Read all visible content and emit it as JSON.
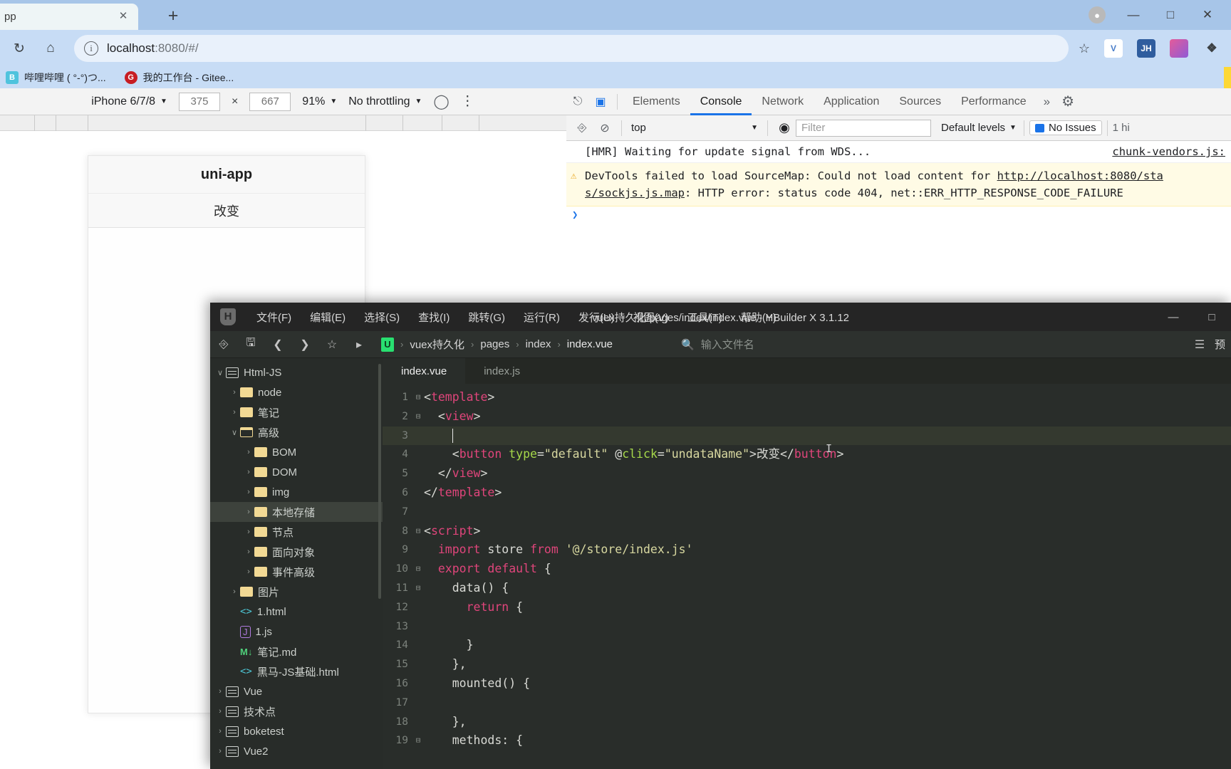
{
  "browser": {
    "tab_title": "pp",
    "close_icon": "close-icon",
    "new_tab_icon": "plus-icon",
    "reload_icon": "reload-icon",
    "home_icon": "home-icon",
    "url_info_icon": "info-icon",
    "url": "localhost:8080/#/",
    "url_host": "localhost",
    "url_path": ":8080/#/",
    "star_icon": "star-icon",
    "extensions": [
      {
        "name": "extension-v",
        "label": "V",
        "color": "#f0f0f0",
        "text_color": "#4a7ec9"
      },
      {
        "name": "extension-jh",
        "label": "JH",
        "color": "#2f5d9e",
        "text_color": "#ffffff"
      },
      {
        "name": "extension-colorful",
        "label": "",
        "color": "#d94f7a",
        "text_color": "#ffffff"
      },
      {
        "name": "extension-puzzle",
        "label": "❖",
        "color": "transparent",
        "text_color": "#3c4043"
      }
    ],
    "window_buttons": [
      "—",
      "□",
      "✕"
    ],
    "bookmarks": [
      {
        "label": "哔哩哔哩 ( °-°)つ...",
        "icon_label": "B",
        "icon_color": "#4fc3dd"
      },
      {
        "label": "我的工作台 - Gitee...",
        "icon_label": "G",
        "icon_color": "#c71d23"
      }
    ]
  },
  "devtools": {
    "device_toolbar": {
      "device": "iPhone 6/7/8",
      "width": "375",
      "height": "667",
      "separator": "×",
      "zoom": "91%",
      "throttling": "No throttling",
      "rotate_icon": "rotate-icon",
      "more_icon": "kebab-menu-icon"
    },
    "panel_tabs": [
      {
        "label": "Elements",
        "selected": false
      },
      {
        "label": "Console",
        "selected": true
      },
      {
        "label": "Network",
        "selected": false
      },
      {
        "label": "Application",
        "selected": false
      },
      {
        "label": "Sources",
        "selected": false
      },
      {
        "label": "Performance",
        "selected": false
      }
    ],
    "more_tabs": "»",
    "settings_icon": "gear-icon",
    "inspect_icon": "inspect-element-icon",
    "device_toggle_icon": "device-toolbar-icon",
    "console_toolbar": {
      "sidebar_icon": "console-sidebar-icon",
      "clear_icon": "clear-console-icon",
      "context": "top",
      "eye_icon": "live-expression-icon",
      "filter_placeholder": "Filter",
      "levels": "Default levels",
      "issues": "No Issues",
      "hidden": "1 hi"
    },
    "messages": [
      {
        "type": "log",
        "text": "[HMR] Waiting for update signal from WDS...",
        "source": "chunk-vendors.js:"
      },
      {
        "type": "warning",
        "text_part1": "DevTools failed to load SourceMap: Could not load content for ",
        "link1": "http://localhost:8080/sta",
        "link2": "s/sockjs.js.map",
        "text_part2": ": HTTP error: status code 404, net::ERR_HTTP_RESPONSE_CODE_FAILURE"
      }
    ]
  },
  "preview": {
    "app_title": "uni-app",
    "button_label": "改变"
  },
  "hbuilder": {
    "window_title": "vuex持久化/pages/index/index.vue - HBuilder X 3.1.12",
    "logo": "H",
    "menus": [
      "文件(F)",
      "编辑(E)",
      "选择(S)",
      "查找(I)",
      "跳转(G)",
      "运行(R)",
      "发行(U)",
      "视图(V)",
      "工具(T)",
      "帮助(Y)"
    ],
    "window_buttons": [
      "—",
      "□"
    ],
    "toolbar_icons": [
      "toggle-sidebar-icon",
      "save-icon",
      "back-icon",
      "forward-icon",
      "favorite-icon",
      "run-icon"
    ],
    "breadcrumb": {
      "project_icon": "uniapp-project-icon",
      "items": [
        "vuex持久化",
        "pages",
        "index",
        "index.vue"
      ],
      "separator": "›"
    },
    "file_search_placeholder": "输入文件名",
    "file_search_icon": "file-search-icon",
    "filter_icon": "filter-icon",
    "preview_label": "预",
    "tree": [
      {
        "label": "Html-JS",
        "depth": 0,
        "twisty": "∨",
        "icon": "project",
        "selected": false
      },
      {
        "label": "node",
        "depth": 1,
        "twisty": "›",
        "icon": "folder-closed",
        "selected": false
      },
      {
        "label": "笔记",
        "depth": 1,
        "twisty": "›",
        "icon": "folder-closed",
        "selected": false
      },
      {
        "label": "高级",
        "depth": 1,
        "twisty": "∨",
        "icon": "folder-open",
        "selected": false
      },
      {
        "label": "BOM",
        "depth": 2,
        "twisty": "›",
        "icon": "folder-closed",
        "selected": false
      },
      {
        "label": "DOM",
        "depth": 2,
        "twisty": "›",
        "icon": "folder-closed",
        "selected": false
      },
      {
        "label": "img",
        "depth": 2,
        "twisty": "›",
        "icon": "folder-closed",
        "selected": false
      },
      {
        "label": "本地存储",
        "depth": 2,
        "twisty": "›",
        "icon": "folder-closed",
        "selected": true
      },
      {
        "label": "节点",
        "depth": 2,
        "twisty": "›",
        "icon": "folder-closed",
        "selected": false
      },
      {
        "label": "面向对象",
        "depth": 2,
        "twisty": "›",
        "icon": "folder-closed",
        "selected": false
      },
      {
        "label": "事件高级",
        "depth": 2,
        "twisty": "›",
        "icon": "folder-closed",
        "selected": false
      },
      {
        "label": "图片",
        "depth": 1,
        "twisty": "›",
        "icon": "folder-closed",
        "selected": false
      },
      {
        "label": "1.html",
        "depth": 1,
        "twisty": "",
        "icon": "html",
        "selected": false
      },
      {
        "label": "1.js",
        "depth": 1,
        "twisty": "",
        "icon": "js",
        "selected": false
      },
      {
        "label": "笔记.md",
        "depth": 1,
        "twisty": "",
        "icon": "md",
        "selected": false
      },
      {
        "label": "黑马-JS基础.html",
        "depth": 1,
        "twisty": "",
        "icon": "html",
        "selected": false
      },
      {
        "label": "Vue",
        "depth": 0,
        "twisty": "›",
        "icon": "project",
        "selected": false
      },
      {
        "label": "技术点",
        "depth": 0,
        "twisty": "›",
        "icon": "project",
        "selected": false
      },
      {
        "label": "boketest",
        "depth": 0,
        "twisty": "›",
        "icon": "project",
        "selected": false
      },
      {
        "label": "Vue2",
        "depth": 0,
        "twisty": "›",
        "icon": "project",
        "selected": false
      }
    ],
    "editor_tabs": [
      {
        "label": "index.vue",
        "selected": true
      },
      {
        "label": "index.js",
        "selected": false
      }
    ],
    "code_lines": [
      {
        "n": "1",
        "fold": "⊟",
        "cur": false,
        "text": "<template>"
      },
      {
        "n": "2",
        "fold": "⊟",
        "cur": false,
        "text": "  <view>"
      },
      {
        "n": "3",
        "fold": "",
        "cur": true,
        "text": "    "
      },
      {
        "n": "4",
        "fold": "",
        "cur": false,
        "text": "    <button type=\"default\" @click=\"undataName\">改变</button>"
      },
      {
        "n": "5",
        "fold": "",
        "cur": false,
        "text": "  </view>"
      },
      {
        "n": "6",
        "fold": "",
        "cur": false,
        "text": "</template>"
      },
      {
        "n": "7",
        "fold": "",
        "cur": false,
        "text": ""
      },
      {
        "n": "8",
        "fold": "⊟",
        "cur": false,
        "text": "<script>"
      },
      {
        "n": "9",
        "fold": "",
        "cur": false,
        "text": "  import store from '@/store/index.js'"
      },
      {
        "n": "10",
        "fold": "⊟",
        "cur": false,
        "text": "  export default {"
      },
      {
        "n": "11",
        "fold": "⊟",
        "cur": false,
        "text": "    data() {"
      },
      {
        "n": "12",
        "fold": "",
        "cur": false,
        "text": "      return {"
      },
      {
        "n": "13",
        "fold": "",
        "cur": false,
        "text": ""
      },
      {
        "n": "14",
        "fold": "",
        "cur": false,
        "text": "      }"
      },
      {
        "n": "15",
        "fold": "",
        "cur": false,
        "text": "    },"
      },
      {
        "n": "16",
        "fold": "",
        "cur": false,
        "text": "    mounted() {"
      },
      {
        "n": "17",
        "fold": "",
        "cur": false,
        "text": ""
      },
      {
        "n": "18",
        "fold": "",
        "cur": false,
        "text": "    },"
      },
      {
        "n": "19",
        "fold": "⊟",
        "cur": false,
        "text": "    methods: {"
      }
    ]
  }
}
